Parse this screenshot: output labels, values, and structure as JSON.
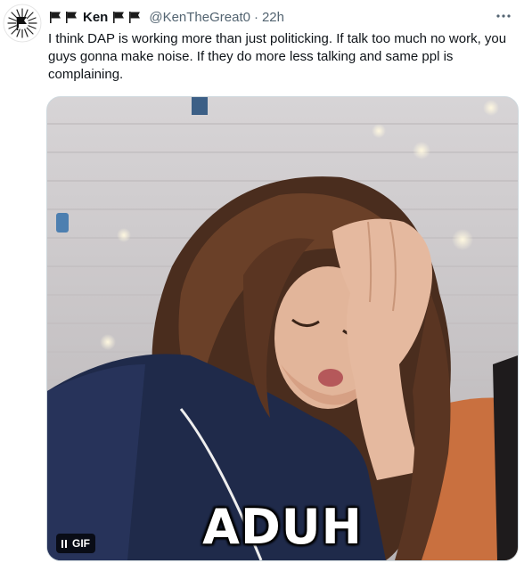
{
  "tweet": {
    "display_name": "Ken",
    "handle": "@KenTheGreat0",
    "separator": "·",
    "time": "22h",
    "name_icons": [
      "flag-icon",
      "flag-icon",
      "flag-icon",
      "flag-icon"
    ],
    "text": "I think DAP is working more than just politicking. If talk too much no work, you guys gonna make noise. If they do more less talking and same ppl is complaining.",
    "more_icon": "more-horizontal-icon"
  },
  "media": {
    "caption": "ADUH",
    "badge_label": "GIF",
    "badge_icon": "pause-icon"
  },
  "colors": {
    "text_primary": "#0f1419",
    "text_secondary": "#536471",
    "media_border": "#cfd9de"
  }
}
